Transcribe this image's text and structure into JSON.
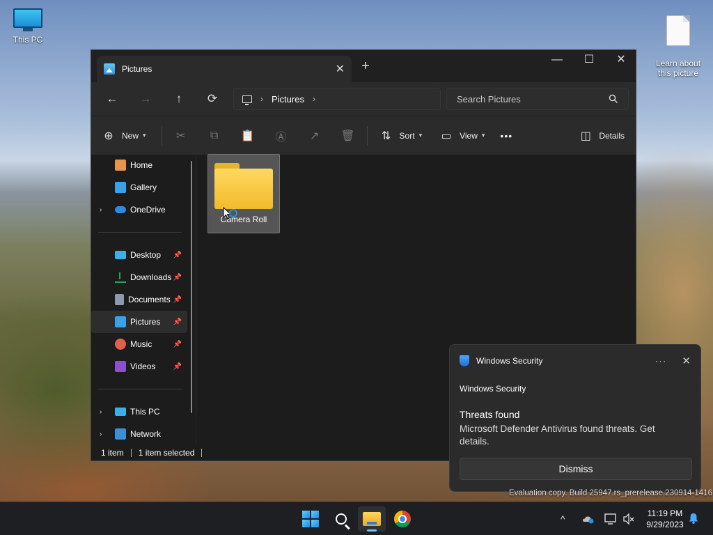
{
  "desktop": {
    "icons": [
      {
        "label": "This PC"
      },
      {
        "label": "Learn about\nthis picture"
      }
    ],
    "watermark": "Evaluation copy. Build 25947.rs_prerelease.230914-1416"
  },
  "explorer": {
    "tab_title": "Pictures",
    "new_tab": "+",
    "window_controls": {
      "minimize": "—",
      "maximize": "☐",
      "close": "✕"
    },
    "nav": {
      "back": "←",
      "forward": "→",
      "up": "↑",
      "refresh": "⟳"
    },
    "breadcrumb": {
      "separator": "›",
      "current": "Pictures"
    },
    "search": {
      "placeholder": "Search Pictures",
      "icon": "search-icon"
    },
    "toolbar": {
      "new_label": "New",
      "sort_label": "Sort",
      "view_label": "View",
      "more_label": "•••",
      "details_label": "Details",
      "icons": {
        "plus": "⊕",
        "cut": "✂",
        "copy": "⧉",
        "paste": "📋",
        "rename": "Ⓐ",
        "share": "↗",
        "delete": "🗑",
        "sort": "⇅",
        "view": "▭",
        "details": "◫"
      }
    },
    "sidebar": {
      "top": [
        {
          "label": "Home",
          "color": "#e8944a"
        },
        {
          "label": "Gallery",
          "color": "#3aa0e8"
        },
        {
          "label": "OneDrive",
          "color": "#2f8ae0",
          "expander": "›"
        }
      ],
      "pinned": [
        {
          "label": "Desktop",
          "color": "#3ab0e8"
        },
        {
          "label": "Downloads",
          "color": "#27a05e"
        },
        {
          "label": "Documents",
          "color": "#8a9ab0"
        },
        {
          "label": "Pictures",
          "color": "#3aa0e8",
          "selected": true
        },
        {
          "label": "Music",
          "color": "#e0604a"
        },
        {
          "label": "Videos",
          "color": "#8a50d0"
        }
      ],
      "pin_glyph": "📌",
      "bottom": [
        {
          "label": "This PC",
          "color": "#3ab0e8",
          "expander": "›"
        },
        {
          "label": "Network",
          "color": "#3a90d0",
          "expander": "›"
        }
      ]
    },
    "content": {
      "items": [
        {
          "label": "Camera Roll",
          "selected": true
        }
      ]
    },
    "status": {
      "count": "1 item",
      "selection": "1 item selected"
    }
  },
  "toast": {
    "app_name": "Windows Security",
    "more": "···",
    "close": "✕",
    "attribution": "Windows Security",
    "title": "Threats found",
    "message": "Microsoft Defender Antivirus found threats. Get details.",
    "dismiss_label": "Dismiss"
  },
  "taskbar": {
    "tray_chevron": "^",
    "time": "11:19 PM",
    "date": "9/29/2023"
  }
}
